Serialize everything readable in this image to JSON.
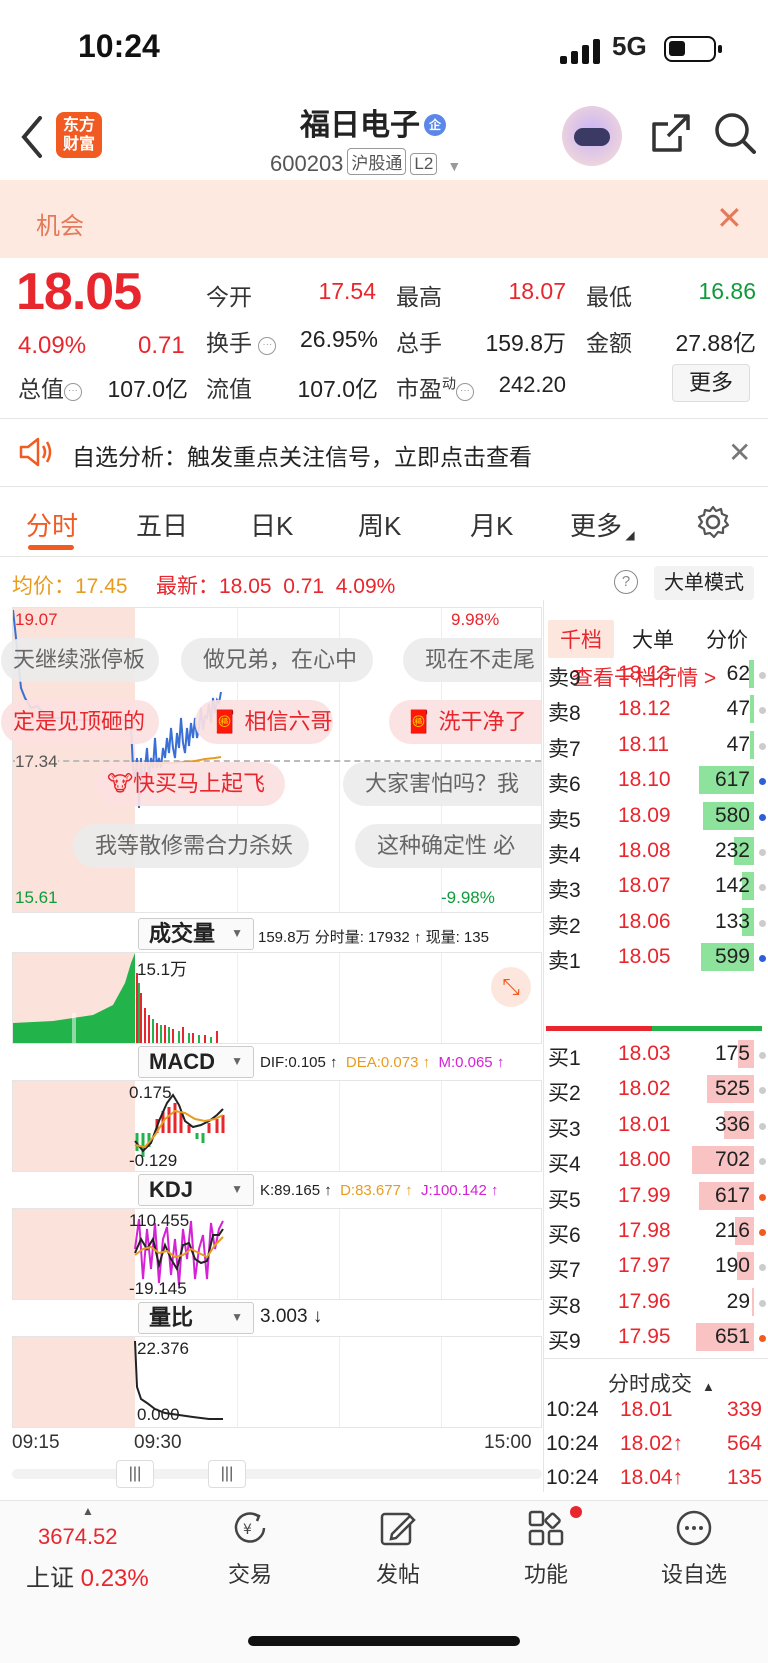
{
  "status_bar": {
    "time": "10:24",
    "network": "5G"
  },
  "header": {
    "logo_text": "东方财富",
    "stock_name": "福日电子",
    "stock_badge": "企",
    "stock_code": "600203",
    "market_tag": "沪股通",
    "level_tag": "L2"
  },
  "opportunity": {
    "label": "机会"
  },
  "quote": {
    "price": "18.05",
    "change_pct": "4.09%",
    "change": "0.71",
    "open_label": "今开",
    "open": "17.54",
    "high_label": "最高",
    "high": "18.07",
    "low_label": "最低",
    "low": "16.86",
    "turnover_label": "换手",
    "turnover": "26.95%",
    "volume_label": "总手",
    "volume": "159.8万",
    "amount_label": "金额",
    "amount": "27.88亿",
    "mktcap_label": "总值",
    "mktcap": "107.0亿",
    "float_label": "流值",
    "float_cap": "107.0亿",
    "pe_label": "市盈",
    "pe_sup": "动",
    "pe": "242.20",
    "more": "更多"
  },
  "analysis": {
    "text": "自选分析：触发重点关注信号，立即点击查看"
  },
  "tabs": [
    "分时",
    "五日",
    "日K",
    "周K",
    "月K",
    "更多"
  ],
  "chart_header": {
    "avg_label": "均价：",
    "avg": "17.45",
    "latest_label": "最新：",
    "latest": "18.05",
    "change": "0.71",
    "change_pct": "4.09%",
    "help": "?",
    "big_mode": "大单模式"
  },
  "chart": {
    "high_label": "19.07",
    "mid_label": "17.34",
    "low_label": "15.61",
    "pct_up": "9.98%",
    "pct_down": "-9.98%",
    "bubbles": [
      "天继续涨停板",
      "做兄弟，在心中",
      "现在不走尾",
      "定是见顶砸的",
      "相信六哥",
      "洗干净了",
      "快买马上起飞",
      "大家害怕吗？我",
      "我等散修需合力杀妖",
      "这种确定性 必"
    ],
    "volume": {
      "selector": "成交量",
      "info": "159.8万 分时量: 17932 ↑ 现量: 135",
      "max_label": "15.1万"
    },
    "macd": {
      "selector": "MACD",
      "dif": "DIF:0.105 ↑",
      "dea": "DEA:0.073 ↑",
      "m": "M:0.065 ↑",
      "top": "0.175",
      "bottom": "-0.129"
    },
    "kdj": {
      "selector": "KDJ",
      "k": "K:89.165 ↑",
      "d": "D:83.677 ↑",
      "j": "J:100.142 ↑",
      "top": "110.455",
      "bottom": "-19.145"
    },
    "vr": {
      "selector": "量比",
      "value": "3.003 ↓",
      "top": "22.376",
      "bottom": "0.000"
    },
    "times": [
      "09:15",
      "09:30",
      "15:00"
    ]
  },
  "order_book": {
    "tabs": [
      "千档",
      "大单",
      "分价"
    ],
    "link": "查看千档行情 >",
    "asks": [
      {
        "label": "卖9",
        "price": "18.13",
        "vol": "62",
        "bar": 0.08,
        "dot": ""
      },
      {
        "label": "卖8",
        "price": "18.12",
        "vol": "47",
        "bar": 0.06,
        "dot": ""
      },
      {
        "label": "卖7",
        "price": "18.11",
        "vol": "47",
        "bar": 0.06,
        "dot": ""
      },
      {
        "label": "卖6",
        "price": "18.10",
        "vol": "617",
        "bar": 0.88,
        "dot": "blue"
      },
      {
        "label": "卖5",
        "price": "18.09",
        "vol": "580",
        "bar": 0.83,
        "dot": "blue"
      },
      {
        "label": "卖4",
        "price": "18.08",
        "vol": "232",
        "bar": 0.33,
        "dot": ""
      },
      {
        "label": "卖3",
        "price": "18.07",
        "vol": "142",
        "bar": 0.2,
        "dot": ""
      },
      {
        "label": "卖2",
        "price": "18.06",
        "vol": "133",
        "bar": 0.19,
        "dot": ""
      },
      {
        "label": "卖1",
        "price": "18.05",
        "vol": "599",
        "bar": 0.85,
        "dot": "blue"
      }
    ],
    "bids": [
      {
        "label": "买1",
        "price": "18.03",
        "vol": "175",
        "bar": 0.25,
        "dot": ""
      },
      {
        "label": "买2",
        "price": "18.02",
        "vol": "525",
        "bar": 0.75,
        "dot": ""
      },
      {
        "label": "买3",
        "price": "18.01",
        "vol": "336",
        "bar": 0.48,
        "dot": ""
      },
      {
        "label": "买4",
        "price": "18.00",
        "vol": "702",
        "bar": 1.0,
        "dot": ""
      },
      {
        "label": "买5",
        "price": "17.99",
        "vol": "617",
        "bar": 0.88,
        "dot": "orange"
      },
      {
        "label": "买6",
        "price": "17.98",
        "vol": "216",
        "bar": 0.31,
        "dot": "orange"
      },
      {
        "label": "买7",
        "price": "17.97",
        "vol": "190",
        "bar": 0.27,
        "dot": ""
      },
      {
        "label": "买8",
        "price": "17.96",
        "vol": "29",
        "bar": 0.04,
        "dot": ""
      },
      {
        "label": "买9",
        "price": "17.95",
        "vol": "651",
        "bar": 0.93,
        "dot": "orange"
      }
    ],
    "trades_header": "分时成交",
    "trades": [
      {
        "time": "10:24",
        "price": "18.01",
        "vol": "339",
        "color": "red"
      },
      {
        "time": "10:24",
        "price": "18.02↑",
        "vol": "564",
        "color": "red"
      },
      {
        "time": "10:24",
        "price": "18.04↑",
        "vol": "135",
        "color": "red"
      }
    ]
  },
  "bottom_nav": {
    "index_value": "3674.52",
    "index_name": "上证",
    "index_pct": "0.23%",
    "items": [
      "交易",
      "发帖",
      "功能",
      "设自选"
    ]
  },
  "colors": {
    "up": "#e8262d",
    "down": "#109b3a",
    "accent": "#f15b22",
    "avg_line": "#e89c1e",
    "price_line": "#3a6fd6"
  }
}
